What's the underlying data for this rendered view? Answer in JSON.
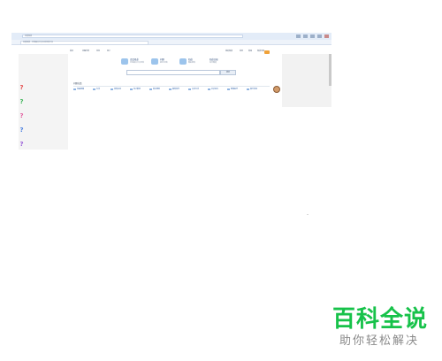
{
  "browser": {
    "title": "百度知道",
    "tab_label": "百度知道 - 全球最大中文互动问答平台"
  },
  "nav": {
    "left": [
      "首页",
      "问题分类",
      "特色",
      "用户"
    ],
    "right": [
      "我的知道",
      "消息",
      "商城",
      "知道日报"
    ]
  },
  "header_blocks": [
    {
      "title": "百度知道",
      "sub": "全球最大中文问答"
    },
    {
      "title": "问题",
      "sub": "提问 回答"
    },
    {
      "title": "知道",
      "sub": "精彩推荐"
    },
    {
      "title": "知道日报",
      "sub": "每日精选"
    }
  ],
  "search": {
    "button_label": "搜索"
  },
  "section": {
    "title": "问题分类"
  },
  "categories": [
    "电脑网络",
    "生活",
    "体育运动",
    "电子数码",
    "商业理财",
    "教育科学",
    "文化艺术",
    "社会民生",
    "健康医疗",
    "娱乐休闲"
  ],
  "left_icons": [
    {
      "name": "question-icon-red",
      "color": "#e54b4b"
    },
    {
      "name": "question-icon-green",
      "color": "#3fb55a"
    },
    {
      "name": "question-icon-pink",
      "color": "#e25fa0"
    },
    {
      "name": "question-icon-blue",
      "color": "#4a7fe0"
    },
    {
      "name": "question-icon-purple",
      "color": "#9a5fd8"
    }
  ],
  "watermark": {
    "title": "百科全说",
    "subtitle": "助你轻松解决",
    "color": "#17c24a"
  }
}
